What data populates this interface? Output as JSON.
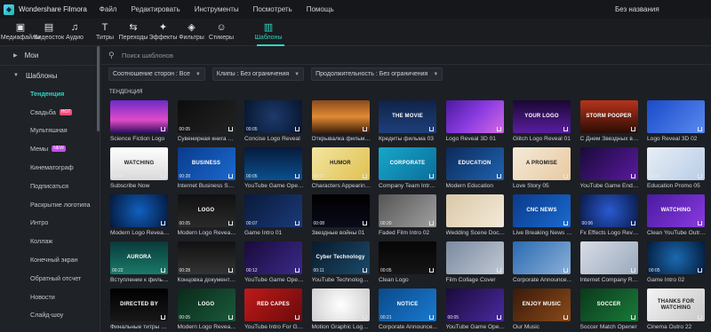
{
  "app": {
    "name": "Wondershare Filmora",
    "doc_title": "Без названия"
  },
  "menu": [
    "Файл",
    "Редактировать",
    "Инструменты",
    "Посмотреть",
    "Помощь"
  ],
  "toolbar": [
    {
      "label": "Медиафайлы",
      "icon": "media-icon",
      "glyph": "▣"
    },
    {
      "label": "Видеосток",
      "icon": "stock-video-icon",
      "glyph": "▤"
    },
    {
      "label": "Аудио",
      "icon": "music-icon",
      "glyph": "♫"
    },
    {
      "label": "Титры",
      "icon": "text-icon",
      "glyph": "T"
    },
    {
      "label": "Переходы",
      "icon": "transition-icon",
      "glyph": "⇆"
    },
    {
      "label": "Эффекты",
      "icon": "effects-icon",
      "glyph": "✦"
    },
    {
      "label": "Фильтры",
      "icon": "filter-icon",
      "glyph": "◈"
    },
    {
      "label": "Стикеры",
      "icon": "sticker-icon",
      "glyph": "☺"
    },
    {
      "label": "Шаблоны",
      "icon": "template-icon",
      "glyph": "▥",
      "active": true
    }
  ],
  "sidebar": {
    "my": "Мои",
    "templates": "Шаблоны",
    "items": [
      {
        "label": "Тенденция",
        "active": true
      },
      {
        "label": "Свадьба",
        "badge": "HOT"
      },
      {
        "label": "Мультяшная"
      },
      {
        "label": "Мемы",
        "badge": "NEW"
      },
      {
        "label": "Кинематограф"
      },
      {
        "label": "Подписаться"
      },
      {
        "label": "Раскрытие логотипа"
      },
      {
        "label": "Интро"
      },
      {
        "label": "Коллаж"
      },
      {
        "label": "Конечный экран"
      },
      {
        "label": "Обратный отсчет"
      },
      {
        "label": "Новости"
      },
      {
        "label": "Слайд-шоу"
      }
    ]
  },
  "search": {
    "placeholder": "Поиск шаблонов"
  },
  "filters": [
    "Соотношение сторон : Все",
    "Клипы : Без ограничения",
    "Продолжительность : Без ограничения"
  ],
  "section_title": "ТЕНДЕНЦИЯ",
  "templates": [
    {
      "label": "Science Fiction Logo",
      "thumb": "",
      "dur": "",
      "bg": "linear-gradient(180deg,#6c2ac8,#e04bc7 60%,#2a0f5a)"
    },
    {
      "label": "Сувенирная книга дл...",
      "thumb": "",
      "dur": "00:05",
      "bg": "linear-gradient(135deg,#0d0d0d,#222)"
    },
    {
      "label": "Concise Logo Reveal",
      "thumb": "",
      "dur": "00:05",
      "bg": "radial-gradient(circle,#1d3a6b,#07152e)"
    },
    {
      "label": "Открывалка фильма ...",
      "thumb": "",
      "dur": "",
      "bg": "linear-gradient(180deg,#8a4a1c,#e08a34 50%,#3a1d0a)"
    },
    {
      "label": "Кредиты фильма 03",
      "thumb": "THE MOVIE",
      "dur": "",
      "bg": "linear-gradient(180deg,#102348,#1e3f7a)"
    },
    {
      "label": "Logo Reveal 3D 01",
      "thumb": "",
      "dur": "",
      "bg": "linear-gradient(135deg,#4a1aa0,#8b3be0,#d56ae6)"
    },
    {
      "label": "Glitch Logo Reveal 01",
      "thumb": "YOUR LOGO",
      "dur": "",
      "bg": "linear-gradient(180deg,#1a0833,#5a1da0)"
    },
    {
      "label": "С Днем Звездных войн",
      "thumb": "STORM POOPER",
      "dur": "",
      "bg": "linear-gradient(180deg,#b8331a,#2a0c06)"
    },
    {
      "label": "Logo Reveal 3D 02",
      "thumb": "",
      "dur": "",
      "bg": "linear-gradient(135deg,#1a4ac8,#5a8af0)"
    },
    {
      "label": "Subscribe Now",
      "thumb": "WATCHING",
      "dur": "00:05",
      "bg": "linear-gradient(180deg,#ffffff,#d9d9d9)",
      "dark": true
    },
    {
      "label": "Internet Business Sum...",
      "thumb": "BUSINESS",
      "dur": "00:28",
      "bg": "linear-gradient(135deg,#0a3a8a,#1a6ad0)"
    },
    {
      "label": "YouTube Game Openi...",
      "thumb": "",
      "dur": "00:05",
      "bg": "linear-gradient(180deg,#061a3a,#0a5090)"
    },
    {
      "label": "Characters Appearing ...",
      "thumb": "HUMOR",
      "dur": "00:07",
      "bg": "linear-gradient(135deg,#f2e6a0,#e0c050)",
      "dark": true
    },
    {
      "label": "Company Team Introd...",
      "thumb": "CORPORATE",
      "dur": "",
      "bg": "linear-gradient(135deg,#16a7c9,#0b6e9a)"
    },
    {
      "label": "Modern Education",
      "thumb": "EDUCATION",
      "dur": "",
      "bg": "linear-gradient(135deg,#0c2a5a,#1f63b0)"
    },
    {
      "label": "Love Story 05",
      "thumb": "A PROMISE",
      "dur": "",
      "bg": "linear-gradient(135deg,#f4ead8,#e8c9a0)",
      "dark": true
    },
    {
      "label": "YouTube Game End Sc...",
      "thumb": "",
      "dur": "",
      "bg": "linear-gradient(135deg,#1a0a3a,#5a1aa0)"
    },
    {
      "label": "Education Promo 05",
      "thumb": "",
      "dur": "00:23",
      "bg": "linear-gradient(135deg,#e8eef6,#b8cde6)",
      "dark": true
    },
    {
      "label": "Modern Logo Reveal 12",
      "thumb": "",
      "dur": "",
      "bg": "radial-gradient(circle,#1060c0,#04183a)"
    },
    {
      "label": "Modern Logo Reveal 09",
      "thumb": "LOGO",
      "dur": "00:05",
      "bg": "linear-gradient(180deg,#101010,#2a2a2a)"
    },
    {
      "label": "Game Intro 01",
      "thumb": "",
      "dur": "00:07",
      "bg": "linear-gradient(135deg,#0a1a3a,#1a3a7a)"
    },
    {
      "label": "Звездные войны 01",
      "thumb": "",
      "dur": "00:08",
      "bg": "linear-gradient(180deg,#000,#0a0a1a)"
    },
    {
      "label": "Faded Film Intro 02",
      "thumb": "",
      "dur": "00:20",
      "bg": "linear-gradient(135deg,#555,#a0a0a0)"
    },
    {
      "label": "Wedding Scene Docu...",
      "thumb": "",
      "dur": "",
      "bg": "linear-gradient(135deg,#d9c8a8,#f4ead8)",
      "dark": true
    },
    {
      "label": "Live Breaking News In...",
      "thumb": "CNC NEWS",
      "dur": "",
      "bg": "linear-gradient(135deg,#0a3a8a,#1a6ad0)"
    },
    {
      "label": "Fx Effects Logo Reveal",
      "thumb": "",
      "dur": "00:06",
      "bg": "radial-gradient(circle,#2a5ad0,#0a1a4a)"
    },
    {
      "label": "Clean YouTube Outro 02",
      "thumb": "WATCHING",
      "dur": "",
      "bg": "linear-gradient(135deg,#4a1aa0,#8a3ae0)"
    },
    {
      "label": "Вступление к фильм...",
      "thumb": "AURORA",
      "dur": "00:22",
      "bg": "linear-gradient(180deg,#0a3a3a,#1a7a6a)"
    },
    {
      "label": "Концовка документа...",
      "thumb": "",
      "dur": "00:28",
      "bg": "linear-gradient(180deg,#111,#333)"
    },
    {
      "label": "YouTube Game Opene...",
      "thumb": "",
      "dur": "00:12",
      "bg": "linear-gradient(135deg,#1a0a3a,#3a2a8a)"
    },
    {
      "label": "YouTube Technology ...",
      "thumb": "Cyber Technology",
      "dur": "00:11",
      "bg": "linear-gradient(135deg,#0a1a2a,#1a4a6a)"
    },
    {
      "label": "Clean Logo",
      "thumb": "",
      "dur": "00:05",
      "bg": "linear-gradient(180deg,#050505,#151515)"
    },
    {
      "label": "Film Collage Cover",
      "thumb": "",
      "dur": "",
      "bg": "linear-gradient(135deg,#7a8aa0,#c0c8d4)"
    },
    {
      "label": "Corporate Announce...",
      "thumb": "",
      "dur": "",
      "bg": "linear-gradient(135deg,#2a6ab0,#8ab0d8)"
    },
    {
      "label": "Internet Company Rec...",
      "thumb": "",
      "dur": "",
      "bg": "linear-gradient(135deg,#d8dde6,#9aa8bc)",
      "dark": true
    },
    {
      "label": "Game Intro 02",
      "thumb": "",
      "dur": "00:05",
      "bg": "radial-gradient(circle,#1a6ab0,#041a3a)"
    },
    {
      "label": "Финальные титры ф...",
      "thumb": "DIRECTED BY",
      "dur": "",
      "bg": "linear-gradient(180deg,#000,#181818)"
    },
    {
      "label": "Modern Logo Reveal 15",
      "thumb": "LOGO",
      "dur": "00:05",
      "bg": "linear-gradient(135deg,#0a2a1a,#1a5a3a)"
    },
    {
      "label": "YouTube Intro For Ga...",
      "thumb": "RED CAPES",
      "dur": "",
      "bg": "linear-gradient(135deg,#c01a1a,#6a0a0a)"
    },
    {
      "label": "Motion Graphic Logo ...",
      "thumb": "",
      "dur": "",
      "bg": "radial-gradient(circle,#ffffff,#cfcfcf)",
      "dark": true
    },
    {
      "label": "Corporate Announce...",
      "thumb": "NOTICE",
      "dur": "00:21",
      "bg": "linear-gradient(135deg,#0a4a8a,#1a7ad0)"
    },
    {
      "label": "YouTube Game Opene...",
      "thumb": "",
      "dur": "00:05",
      "bg": "linear-gradient(135deg,#1a0a3a,#4a2aa0)"
    },
    {
      "label": "Our Music",
      "thumb": "ENJOY MUSIC",
      "dur": "",
      "bg": "linear-gradient(135deg,#3a1a0a,#8a4a1a)"
    },
    {
      "label": "Soccer Match Opener",
      "thumb": "SOCCER",
      "dur": "",
      "bg": "linear-gradient(135deg,#0a3a1a,#1a7a3a)"
    },
    {
      "label": "Cinema Outro 22",
      "thumb": "THANKS FOR WATCHING",
      "dur": "",
      "bg": "linear-gradient(135deg,#f4f4f4,#c8c8c8)",
      "dark": true
    }
  ]
}
